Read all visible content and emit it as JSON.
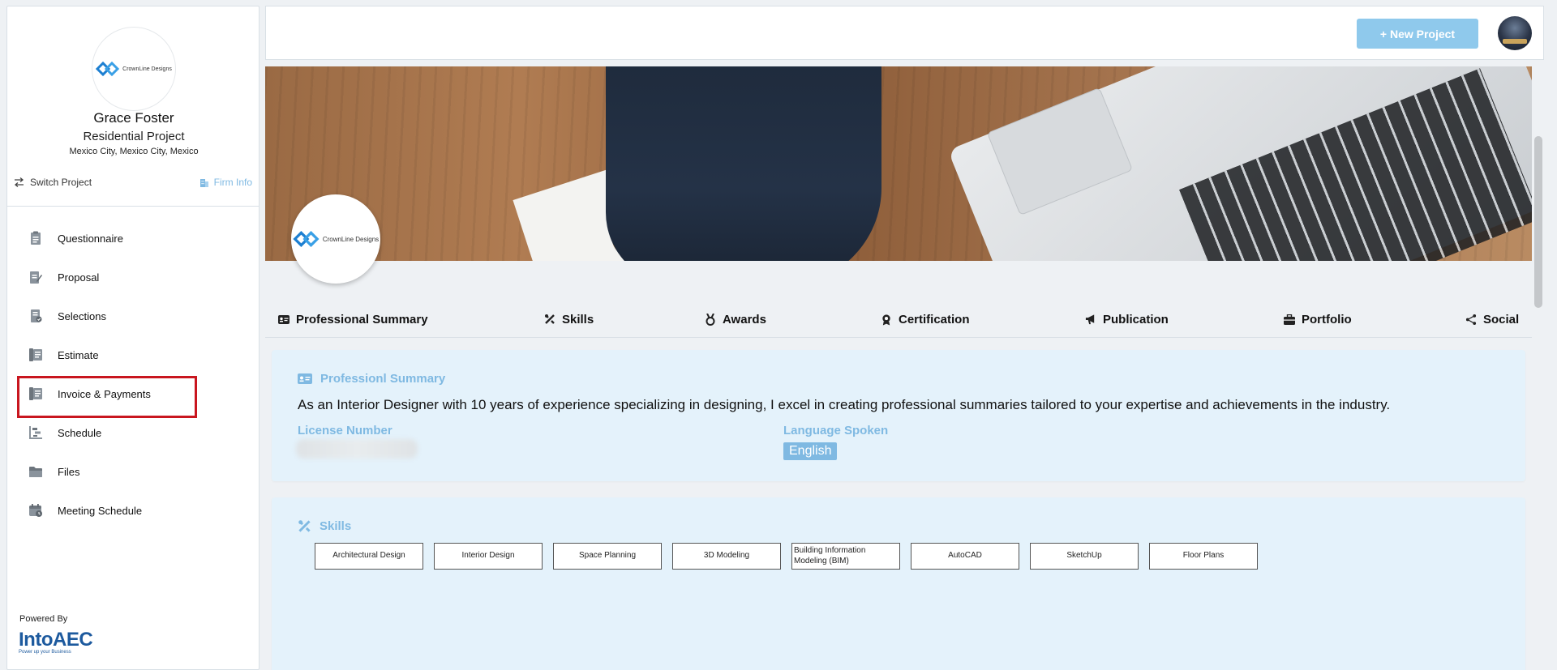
{
  "sidebar": {
    "company_logo_text": "CrownLine Designs",
    "client_name": "Grace Foster",
    "project_name": "Residential Project",
    "location": "Mexico City, Mexico City, Mexico",
    "switch_project": "Switch Project",
    "firm_info": "Firm Info",
    "menu": [
      {
        "label": "Questionnaire",
        "icon": "questionnaire-icon"
      },
      {
        "label": "Proposal",
        "icon": "proposal-icon"
      },
      {
        "label": "Selections",
        "icon": "selections-icon"
      },
      {
        "label": "Estimate",
        "icon": "estimate-icon"
      },
      {
        "label": "Invoice & Payments",
        "icon": "invoice-icon"
      },
      {
        "label": "Schedule",
        "icon": "schedule-icon"
      },
      {
        "label": "Files",
        "icon": "folder-icon"
      },
      {
        "label": "Meeting Schedule",
        "icon": "calendar-icon"
      }
    ],
    "powered_by": "Powered By",
    "brand_name": "IntoAEC",
    "brand_tagline": "Power up your Business"
  },
  "topbar": {
    "new_project": "+ New Project"
  },
  "profile": {
    "company_logo_text": "CrownLine Designs",
    "tabs": [
      {
        "label": "Professional Summary",
        "icon": "id-card-icon"
      },
      {
        "label": "Skills",
        "icon": "tools-icon"
      },
      {
        "label": "Awards",
        "icon": "medal-icon"
      },
      {
        "label": "Certification",
        "icon": "certificate-icon"
      },
      {
        "label": "Publication",
        "icon": "megaphone-icon"
      },
      {
        "label": "Portfolio",
        "icon": "briefcase-icon"
      },
      {
        "label": "Social",
        "icon": "share-icon"
      }
    ],
    "summary": {
      "title": "Professionl Summary",
      "text": "As an Interior Designer with 10 years of experience specializing in designing, I excel in creating professional summaries tailored to your expertise and achievements in the industry.",
      "license_label": "License Number",
      "language_label": "Language Spoken",
      "language_value": "English"
    },
    "skills": {
      "title": "Skills",
      "items": [
        "Architectural Design",
        "Interior Design",
        "Space Planning",
        "3D Modeling",
        "Building Information Modeling (BIM)",
        "AutoCAD",
        "SketchUp",
        "Floor Plans"
      ]
    }
  },
  "colors": {
    "accent": "#7fb9e2",
    "button": "#8fc9ec",
    "card_bg": "#e4f2fb",
    "highlight_border": "#c9161f"
  }
}
